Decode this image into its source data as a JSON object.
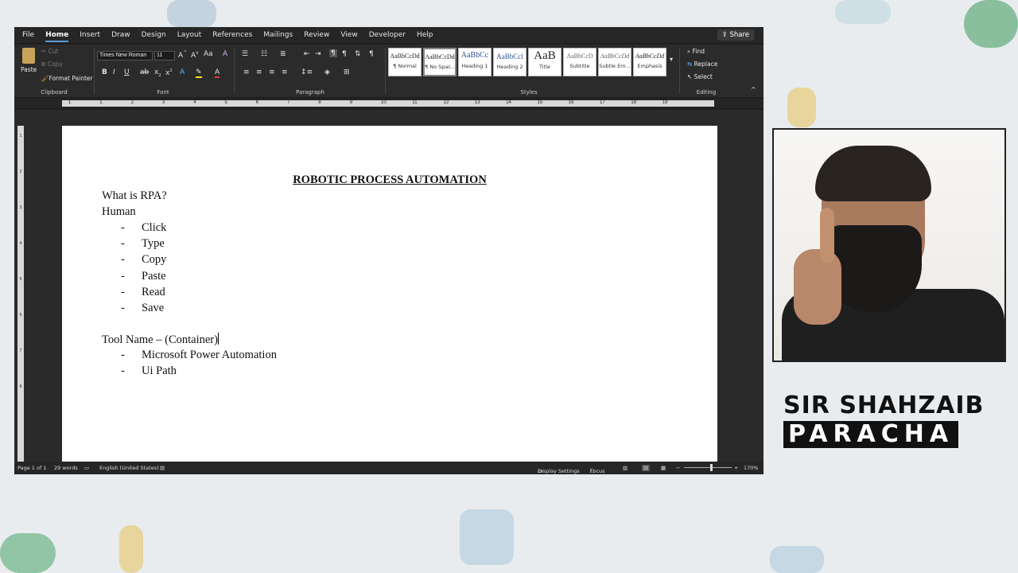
{
  "app": {
    "tabs": [
      "File",
      "Home",
      "Insert",
      "Draw",
      "Design",
      "Layout",
      "References",
      "Mailings",
      "Review",
      "View",
      "Developer",
      "Help"
    ],
    "active_tab": "Home",
    "share_label": "Share"
  },
  "ribbon": {
    "clipboard": {
      "paste": "Paste",
      "cut": "Cut",
      "copy": "Copy",
      "format_painter": "Format Painter",
      "label": "Clipboard"
    },
    "font": {
      "name": "Times New Roman",
      "size": "11",
      "label": "Font"
    },
    "paragraph": {
      "label": "Paragraph"
    },
    "styles": {
      "label": "Styles",
      "items": [
        {
          "preview": "AaBbCcDd",
          "name": "¶ Normal"
        },
        {
          "preview": "AaBbCcDd",
          "name": "¶ No Spac..."
        },
        {
          "preview": "AaBbCc",
          "name": "Heading 1"
        },
        {
          "preview": "AaBbCcl",
          "name": "Heading 2"
        },
        {
          "preview": "AaB",
          "name": "Title"
        },
        {
          "preview": "AaBbCcD",
          "name": "Subtitle"
        },
        {
          "preview": "AaBbCcDd",
          "name": "Subtle Em..."
        },
        {
          "preview": "AaBbCcDd",
          "name": "Emphasis"
        }
      ]
    },
    "editing": {
      "find": "Find",
      "replace": "Replace",
      "select": "Select",
      "label": "Editing"
    }
  },
  "ruler": {
    "ticks": [
      "1",
      "1",
      "2",
      "3",
      "4",
      "5",
      "6",
      "7",
      "8",
      "9",
      "10",
      "11",
      "12",
      "13",
      "14",
      "15",
      "16",
      "17",
      "18",
      "19"
    ]
  },
  "vruler": {
    "ticks": [
      "1",
      "2",
      "3",
      "4",
      "5",
      "6",
      "7",
      "8"
    ]
  },
  "document": {
    "title": "ROBOTIC PROCESS AUTOMATION",
    "q": "What is RPA?",
    "human": "Human",
    "bullet": "-",
    "human_items": [
      "Click",
      "Type",
      "Copy",
      "Paste",
      "Read",
      "Save"
    ],
    "tool_line": "Tool Name – (Container)",
    "tool_items": [
      "Microsoft Power Automation",
      "Ui Path"
    ]
  },
  "status": {
    "page": "Page 1 of 1",
    "words": "29 words",
    "language": "English (United States)",
    "display": "Display Settings",
    "focus": "Focus",
    "zoom": "170%"
  },
  "branding": {
    "line1": "SIR SHAHZAIB",
    "line2": "PARACHA"
  }
}
